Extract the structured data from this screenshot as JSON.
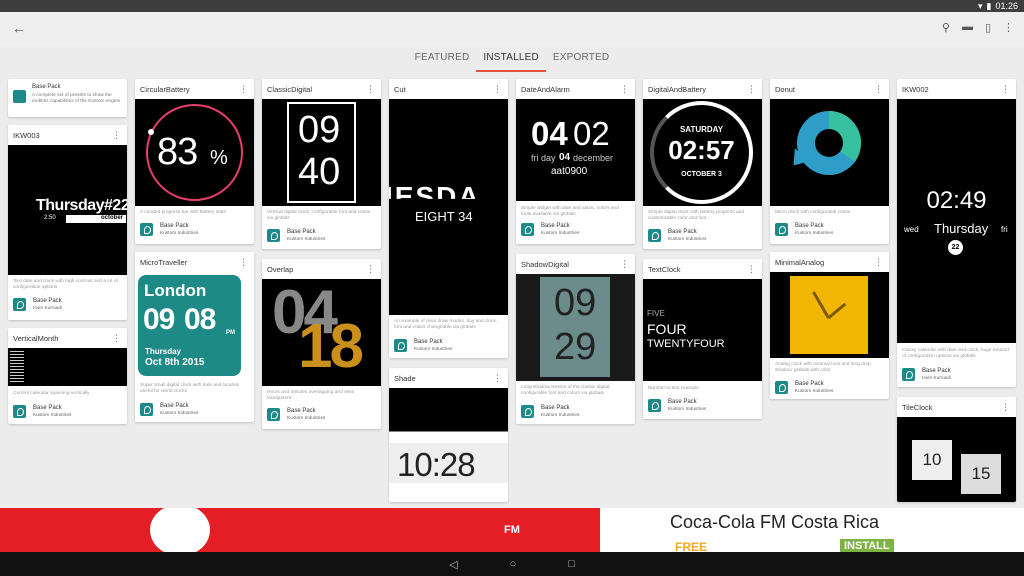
{
  "status": {
    "time": "01:26",
    "icons": [
      "wifi-icon",
      "battery-icon"
    ]
  },
  "tabs": [
    {
      "label": "FEATURED",
      "active": false
    },
    {
      "label": "INSTALLED",
      "active": true
    },
    {
      "label": "EXPORTED",
      "active": false
    }
  ],
  "colors": {
    "accent": "#e0533c",
    "packIcon": "#1d8a8a",
    "adRed": "#e31e24",
    "adGreen": "#7cb342",
    "adOrange": "#f5a623"
  },
  "cards": {
    "basepack": {
      "title": "Base Pack",
      "desc": "A complete set of presets to show the endless capabilities of the Kustom engine"
    },
    "ikw003": {
      "title": "IKW003",
      "prev": {
        "day": "Thursday#22",
        "time": "2:50",
        "month": "october"
      },
      "desc": "Text date and clock with high contrast and a lot of configuration options",
      "pack": "Base Pack",
      "author": "Irwin Kurniadi"
    },
    "verticalmonth": {
      "title": "VerticalMonth",
      "desc": "Current calendar spanning vertically",
      "pack": "Base Pack",
      "author": "Kustom Industries"
    },
    "circularbattery": {
      "title": "CircularBattery",
      "prev": {
        "value": "83",
        "unit": "%"
      },
      "desc": "A curated progress bar with battery stats",
      "pack": "Base Pack",
      "author": "Kustom Industries"
    },
    "microtraveller": {
      "title": "MicroTraveller",
      "prev": {
        "city": "London",
        "hour": "09",
        "min": "08",
        "ampm": "PM",
        "day": "Thursday",
        "date": "Oct 8th 2015"
      },
      "desc": "Super small digital clock with date and location, useful for world clocks",
      "pack": "Base Pack",
      "author": "Kustom Industries"
    },
    "classicdigital": {
      "title": "ClassicDigital",
      "prev": {
        "hour": "09",
        "min": "40"
      },
      "desc": "Vertical digital clock, configurable font and colors via globals",
      "pack": "Base Pack",
      "author": "Kustom Industries"
    },
    "overlap": {
      "title": "Overlap",
      "prev": {
        "hour": "04",
        "min": "18"
      },
      "desc": "Hours and minutes overlapping and semi transparent",
      "pack": "Base Pack",
      "author": "Kustom Industries"
    },
    "cut": {
      "title": "Cut",
      "prev": {
        "big": "IESDA",
        "small": "EIGHT 34"
      },
      "desc": "An example of clear draw modes, day and clock, font and colors changeable via globals",
      "pack": "Base Pack",
      "author": "Kustom Industries"
    },
    "shade": {
      "title": "Shade",
      "prev": {
        "time": "10:28"
      }
    },
    "dateandalarm": {
      "title": "DateAndAlarm",
      "prev": {
        "h": "04",
        "m": "02",
        "line1a": "fri day",
        "line1b": "04",
        "line1c": "december",
        "alarm": "aat0900"
      },
      "desc": "Simple widget with date and alarm, colors and fonts available via globals",
      "pack": "Base Pack",
      "author": "Kustom Industries"
    },
    "shadowdigital": {
      "title": "ShadowDigital",
      "prev": {
        "hour": "09",
        "min": "29"
      },
      "desc": "Long shadow version of the classic digital, configurable font and colors via globals",
      "pack": "Base Pack",
      "author": "Kustom Industries"
    },
    "digitalandbattery": {
      "title": "DigitalAndBattery",
      "prev": {
        "day": "SATURDAY",
        "time": "02:57",
        "date": "OCTOBER 3"
      },
      "desc": "Simple digital clock with battery progress and customizable color and font",
      "pack": "Base Pack",
      "author": "Kustom Industries"
    },
    "textclock": {
      "title": "TextClock",
      "prev": {
        "l1": "FIVE",
        "l2": "FOUR",
        "l3": "TWENTYFOUR"
      },
      "desc": "Number to text example",
      "pack": "Base Pack",
      "author": "Kustom Industries"
    },
    "donut": {
      "title": "Donut",
      "desc": "Micro clock with configurable colors",
      "pack": "Base Pack",
      "author": "Kustom Industries"
    },
    "minimalanalog": {
      "title": "MinimalAnalog",
      "desc": "Analog clock with minimal look and long drop shadow, globals with color",
      "pack": "Base Pack",
      "author": "Kustom Industries"
    },
    "ikw002": {
      "title": "IKW002",
      "prev": {
        "time": "02:49",
        "left": "wed",
        "day": "Thursday",
        "right": "fri",
        "num": "22"
      },
      "desc": "Classy calendar with date and clock, huge amount of configuration options via globals",
      "pack": "Base Pack",
      "author": "Irwin Kurniadi"
    },
    "tileclock": {
      "title": "TileClock",
      "prev": {
        "hour": "10",
        "min": "15"
      }
    }
  },
  "ad": {
    "brand": "FM",
    "title": "Coca-Cola FM Costa Rica",
    "free": "FREE",
    "install": "INSTALL"
  }
}
